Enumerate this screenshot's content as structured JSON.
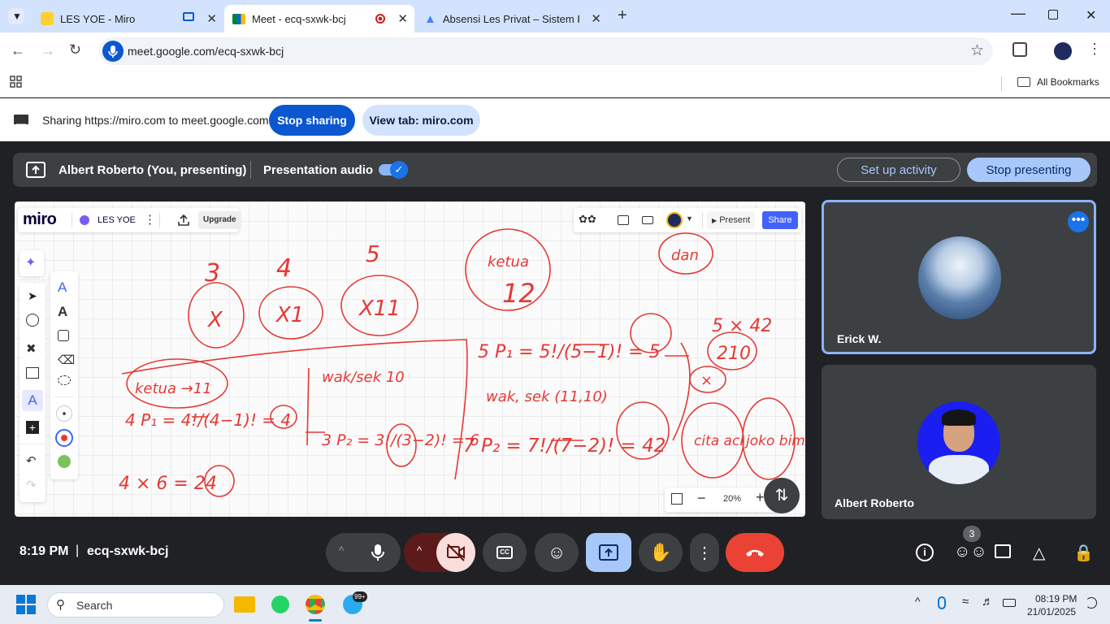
{
  "browser": {
    "tabs": [
      {
        "title": "LES YOE - Miro"
      },
      {
        "title": "Meet - ecq-sxwk-bcj"
      },
      {
        "title": "Absensi Les Privat – Sistem Rua"
      }
    ],
    "url": "meet.google.com/ecq-sxwk-bcj",
    "bookmarks_label": "All Bookmarks"
  },
  "sharing": {
    "message": "Sharing https://miro.com to meet.google.com",
    "stop_label": "Stop sharing",
    "view_label": "View tab: miro.com"
  },
  "presenting": {
    "presenter": "Albert Roberto (You, presenting)",
    "audio_label": "Presentation audio",
    "audio_on": true,
    "activity_label": "Set up activity",
    "stop_label": "Stop presenting"
  },
  "miro": {
    "logo": "miro",
    "board_name": "LES YOE",
    "upgrade_label": "Upgrade",
    "present_label": "Present",
    "share_label": "Share",
    "zoom": "20%",
    "whiteboard": {
      "col_header_3": "3",
      "col_header_4": "4",
      "col_header_5": "5",
      "col_x": "X",
      "col_x1": "X1",
      "col_x11": "X11",
      "circle_ketua_12_a": "ketua",
      "circle_ketua_12_b": "12",
      "circle_dan": "dan",
      "ketua_11": "ketua →11",
      "left_4p1": "4 P₁ = 4!/(4−1)! = 4",
      "left_total": "4 × 6 = 24",
      "wak_sek_10": "wak/sek 10",
      "mid_3p2": "3 P₂ = 3!/(3−2)! = 6",
      "right_5p1": "5 P₁ = 5!/(5−1)! = 5",
      "wak_sek_11_10": "wak, sek (11,10)",
      "right_7p2": "7 P₂ = 7!/(7−2)! = 42",
      "right_5x42": "5 × 42",
      "right_210": "210",
      "right_x": "×",
      "cita_aci": "cita aci",
      "joko_bima": "joko bima"
    }
  },
  "participants": [
    {
      "name": "Erick W."
    },
    {
      "name": "Albert Roberto"
    }
  ],
  "meeting": {
    "time": "8:19 PM",
    "separator": "|",
    "code": "ecq-sxwk-bcj",
    "participant_count": "3"
  },
  "taskbar": {
    "search_placeholder": "Search",
    "telegram_badge": "99+",
    "clock_time": "08:19 PM",
    "clock_date": "21/01/2025"
  },
  "colors": {
    "tab_strip": "#d3e3fd",
    "meet_blue": "#0b57d0",
    "stop_presenting": "#a8c7fa",
    "end_call": "#ea4335",
    "ink": "#e53935",
    "active_tile_border": "#8ab4f8"
  }
}
